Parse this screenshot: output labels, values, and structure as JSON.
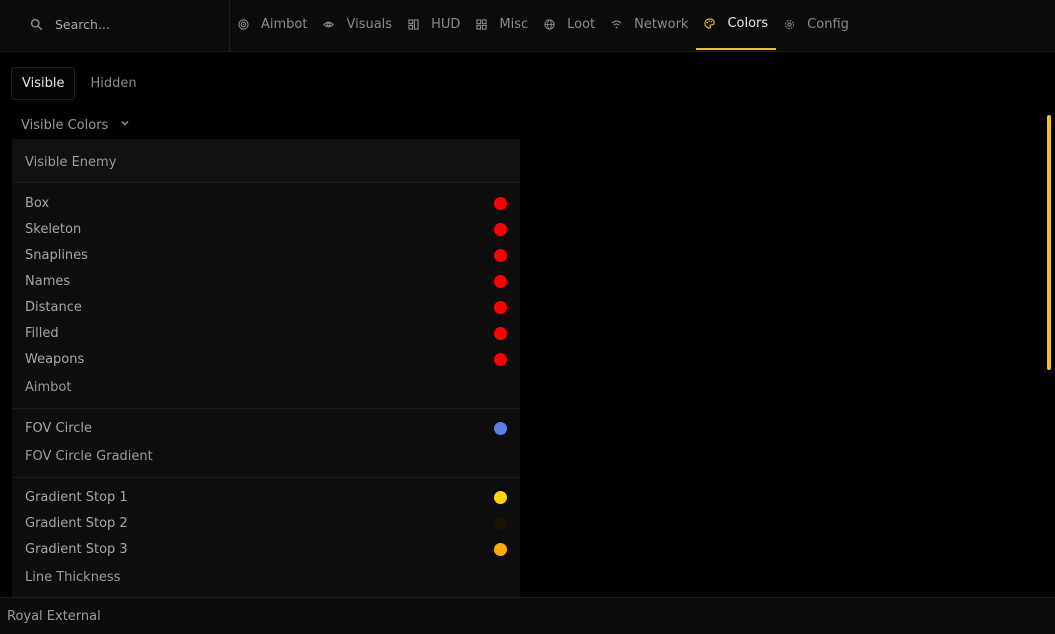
{
  "search": {
    "placeholder": "Search..."
  },
  "tabs": [
    {
      "label": "Aimbot",
      "icon": "target-icon"
    },
    {
      "label": "Visuals",
      "icon": "eye-icon"
    },
    {
      "label": "HUD",
      "icon": "hud-icon"
    },
    {
      "label": "Misc",
      "icon": "grid-icon"
    },
    {
      "label": "Loot",
      "icon": "globe-icon"
    },
    {
      "label": "Network",
      "icon": "wifi-icon"
    },
    {
      "label": "Colors",
      "icon": "palette-icon",
      "active": true
    },
    {
      "label": "Config",
      "icon": "gear-icon"
    }
  ],
  "subtabs": [
    {
      "label": "Visible",
      "active": true
    },
    {
      "label": "Hidden"
    }
  ],
  "dropdown": {
    "label": "Visible Colors"
  },
  "sections": {
    "visible_enemy": "Visible Enemy",
    "aimbot": "Aimbot",
    "fov_gradient": "FOV Circle Gradient",
    "line_thickness": "Line Thickness"
  },
  "rows": [
    {
      "label": "Box",
      "color": "#ff0000"
    },
    {
      "label": "Skeleton",
      "color": "#ff0000"
    },
    {
      "label": "Snaplines",
      "color": "#ff0000"
    },
    {
      "label": "Names",
      "color": "#ff0000"
    },
    {
      "label": "Distance",
      "color": "#ff0000"
    },
    {
      "label": "Filled",
      "color": "#ff0000"
    },
    {
      "label": "Weapons",
      "color": "#ff0000"
    },
    {
      "label": "FOV Circle",
      "color": "#5b7fe8"
    },
    {
      "label": "Gradient Stop 1",
      "color": "#ffd60a"
    },
    {
      "label": "Gradient Stop 2",
      "color": "#1a1200"
    },
    {
      "label": "Gradient Stop 3",
      "color": "#ffaa00"
    }
  ],
  "accent_color": "#f2c311",
  "footer": {
    "title": "Royal External"
  }
}
